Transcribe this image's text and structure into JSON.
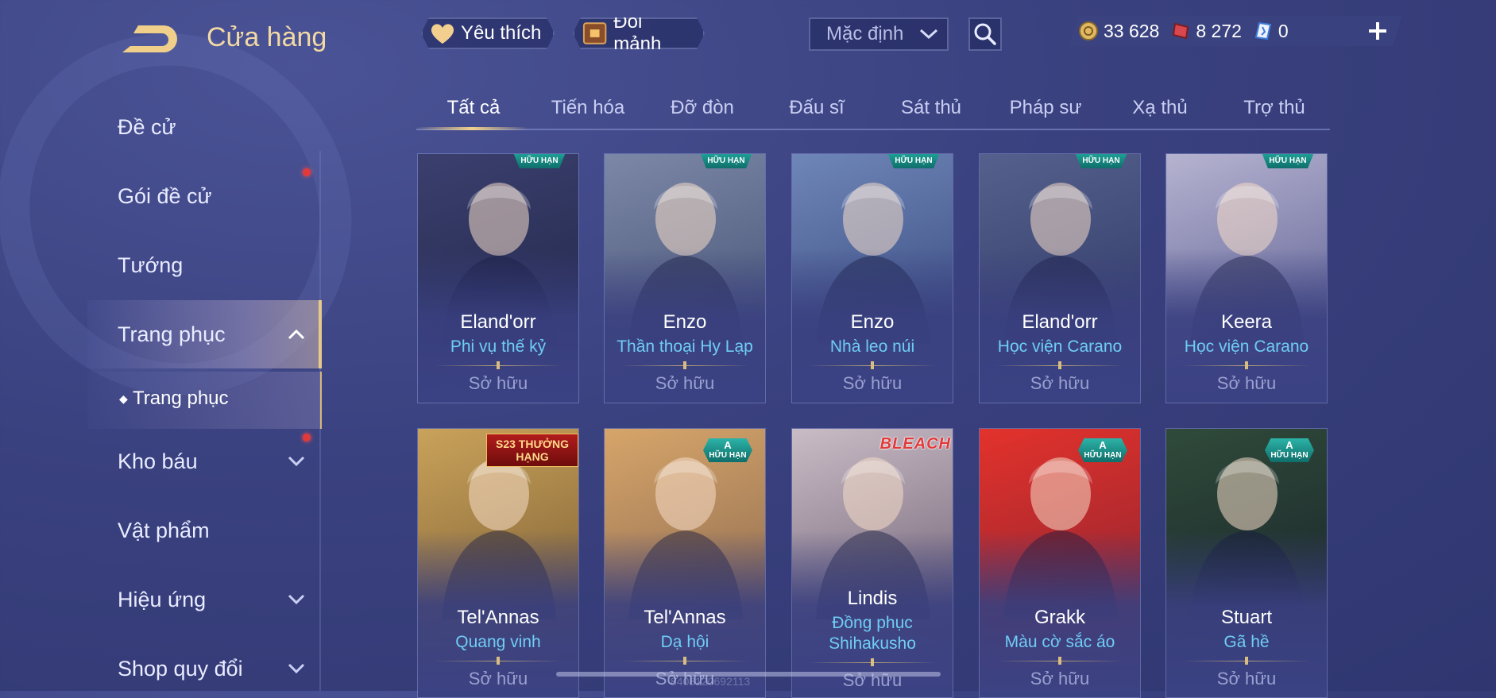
{
  "header": {
    "title": "Cửa hàng",
    "favorites_label": "Yêu thích",
    "fragments_label": "Đổi mảnh",
    "sort_value": "Mặc định"
  },
  "currency": {
    "gold": "33 628",
    "vouchers": "8 272",
    "tokens": "0"
  },
  "sidebar": {
    "items": [
      {
        "label": "Đề cử"
      },
      {
        "label": "Gói đề cử"
      },
      {
        "label": "Tướng"
      },
      {
        "label": "Trang phục"
      },
      {
        "label": "Kho báu"
      },
      {
        "label": "Vật phẩm"
      },
      {
        "label": "Hiệu ứng"
      },
      {
        "label": "Shop quy đổi"
      }
    ],
    "sub_item": "Trang phục"
  },
  "tabs": [
    "Tất cả",
    "Tiến hóa",
    "Đỡ đòn",
    "Đấu sĩ",
    "Sát thủ",
    "Pháp sư",
    "Xạ thủ",
    "Trợ thủ"
  ],
  "cards": [
    {
      "hero": "Eland'orr",
      "skin": "Phi vụ thế kỷ",
      "status": "Sở hữu",
      "badge": "HỮU HẠN",
      "colors": [
        "#3b3f6e",
        "#1e2444"
      ]
    },
    {
      "hero": "Enzo",
      "skin": "Thần thoại Hy Lạp",
      "status": "Sở hữu",
      "badge": "HỮU HẠN",
      "colors": [
        "#7c87a8",
        "#3d4a6a"
      ]
    },
    {
      "hero": "Enzo",
      "skin": "Nhà leo núi",
      "status": "Sở hữu",
      "badge": "HỮU HẠN",
      "colors": [
        "#6f86b8",
        "#2d3e74"
      ]
    },
    {
      "hero": "Eland'orr",
      "skin": "Học viện Carano",
      "status": "Sở hữu",
      "badge": "HỮU HẠN",
      "colors": [
        "#55608c",
        "#2b3460"
      ]
    },
    {
      "hero": "Keera",
      "skin": "Học viện Carano",
      "status": "Sở hữu",
      "badge": "HỮU HẠN",
      "colors": [
        "#b6b3d0",
        "#4b4f88"
      ]
    },
    {
      "hero": "Tel'Annas",
      "skin": "Quang vinh",
      "status": "Sở hữu",
      "tag": "S23 THƯỞNG HẠNG",
      "colors": [
        "#c9a25a",
        "#6a4e2a"
      ]
    },
    {
      "hero": "Tel'Annas",
      "skin": "Dạ hội",
      "status": "Sở hữu",
      "badge_a": "A",
      "badge_a_sub": "HỮU HẠN",
      "colors": [
        "#d6a56a",
        "#7a5a48"
      ]
    },
    {
      "hero": "Lindis",
      "skin": "Đồng phục Shihakusho",
      "status": "Sở hữu",
      "tag": "BLEACH",
      "colors": [
        "#c9bcc6",
        "#5a4a5e"
      ]
    },
    {
      "hero": "Grakk",
      "skin": "Màu cờ sắc áo",
      "status": "Sở hữu",
      "badge_a": "A",
      "badge_a_sub": "HỮU HẠN",
      "colors": [
        "#e3322c",
        "#7a2030"
      ]
    },
    {
      "hero": "Stuart",
      "skin": "Gã hề",
      "status": "Sở hữu",
      "badge_a": "A",
      "badge_a_sub": "HỮU HẠN",
      "colors": [
        "#2f4a3a",
        "#161e28"
      ]
    }
  ],
  "footer": {
    "watermark": "8408120692113"
  },
  "theme": {
    "gold": "#f2d9a4",
    "skin_text": "#6fcdf5",
    "notification": "#e23a3a"
  }
}
